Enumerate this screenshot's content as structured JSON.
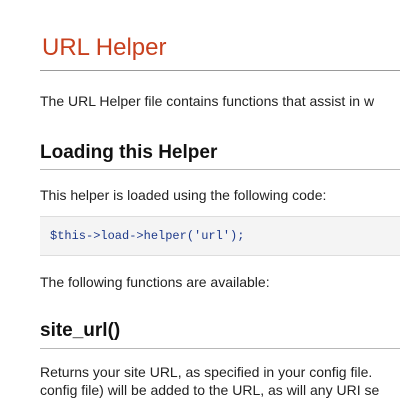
{
  "page": {
    "title": "URL Helper",
    "intro": "The URL Helper file contains functions that assist in w",
    "sections": [
      {
        "heading": "Loading this Helper",
        "text": "This helper is loaded using the following code:",
        "code": "$this->load->helper('url');",
        "after_text": "The following functions are available:"
      },
      {
        "heading": "site_url()",
        "text_line1": "Returns your site URL, as specified in your config file.",
        "text_line2": "config file) will be added to the URL, as will any URI se"
      }
    ]
  },
  "colors": {
    "title": "#c8401e",
    "code": "#1e3a8a",
    "code_bg": "#f4f4f4"
  }
}
